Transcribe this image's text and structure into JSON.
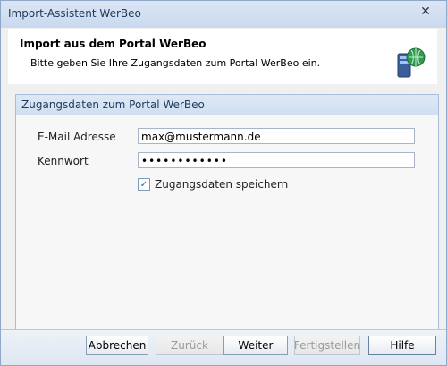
{
  "window": {
    "title": "Import-Assistent WerBeo"
  },
  "header": {
    "title": "Import aus dem Portal WerBeo",
    "subtitle": "Bitte geben Sie Ihre Zugangsdaten zum Portal WerBeo ein."
  },
  "group": {
    "title": "Zugangsdaten zum Portal WerBeo",
    "email_label": "E-Mail Adresse",
    "email_value": "max@mustermann.de",
    "password_label": "Kennwort",
    "password_value": "••••••••••••",
    "remember_label": "Zugangsdaten speichern",
    "remember_checked": true
  },
  "buttons": {
    "cancel": "Abbrechen",
    "back": "Zurück",
    "next": "Weiter",
    "finish": "Fertigstellen",
    "help": "Hilfe"
  }
}
